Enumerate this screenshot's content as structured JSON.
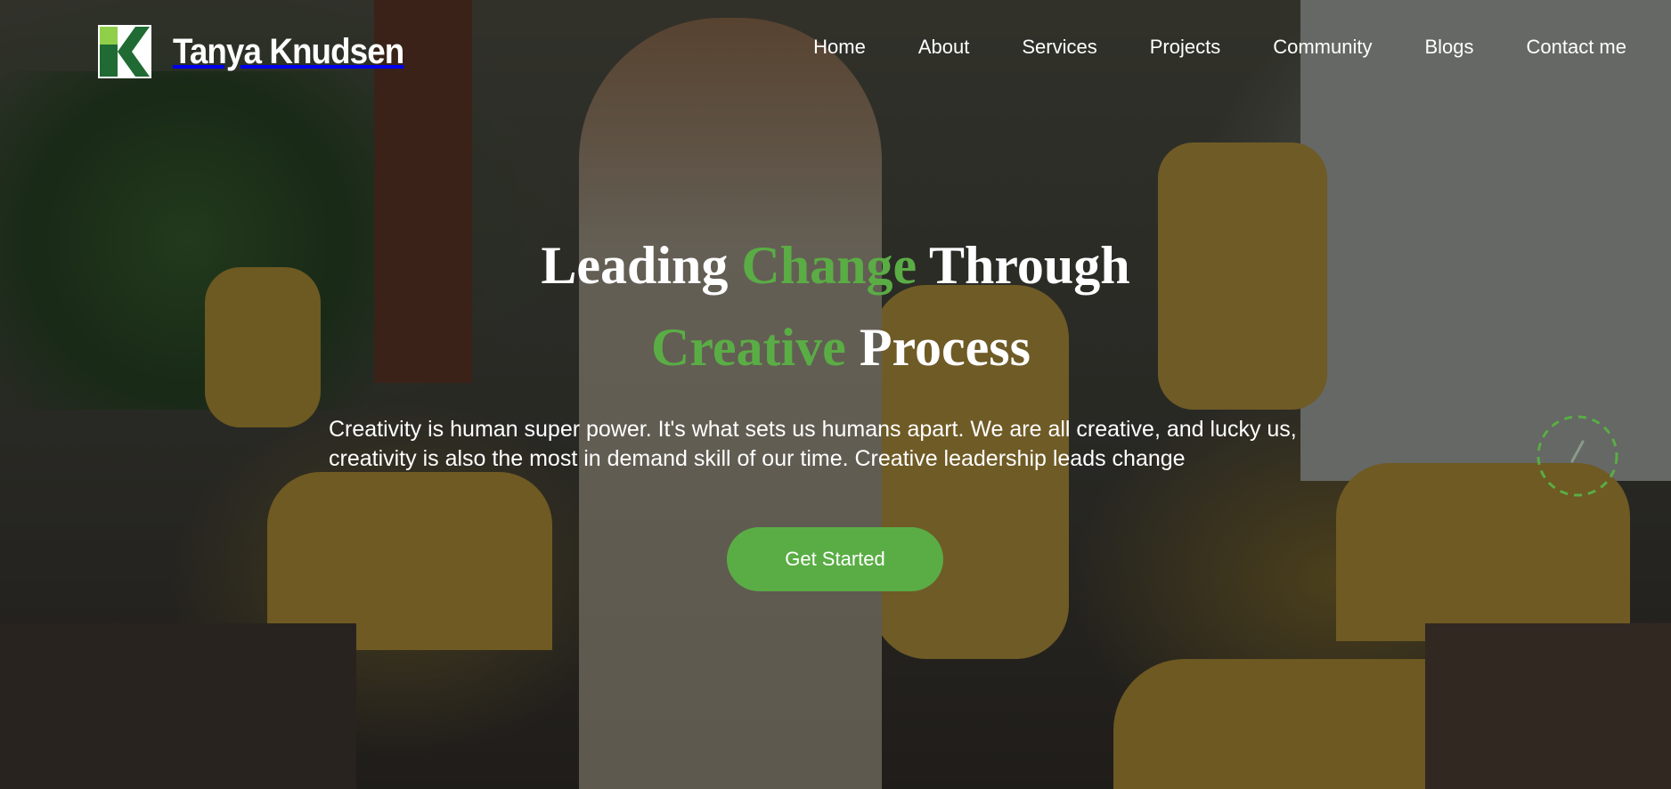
{
  "brand": {
    "name": "Tanya Knudsen",
    "logo_icon": "k-logo-icon"
  },
  "nav": {
    "items": [
      {
        "label": "Home"
      },
      {
        "label": "About"
      },
      {
        "label": "Services"
      },
      {
        "label": "Projects"
      },
      {
        "label": "Community"
      },
      {
        "label": "Blogs"
      },
      {
        "label": "Contact me"
      }
    ]
  },
  "hero": {
    "headline_line1": {
      "part1": "Leading ",
      "part2": "Change",
      "part3": " Through"
    },
    "headline_line2": {
      "part1": "Creative",
      "part2": " Process"
    },
    "subtext_line1": "Creativity is human super power. It's what sets us humans apart. We are all creative, and lucky us,",
    "subtext_line2": "creativity is also the most in demand skill of our time. Creative leadership leads change",
    "cta_label": "Get Started",
    "scroll_icon": "scroll-down-icon"
  },
  "colors": {
    "accent_green": "#5aad45",
    "text_white": "#ffffff",
    "logo_dark_green": "#1f6b33",
    "logo_light_green": "#8fcf4a"
  }
}
